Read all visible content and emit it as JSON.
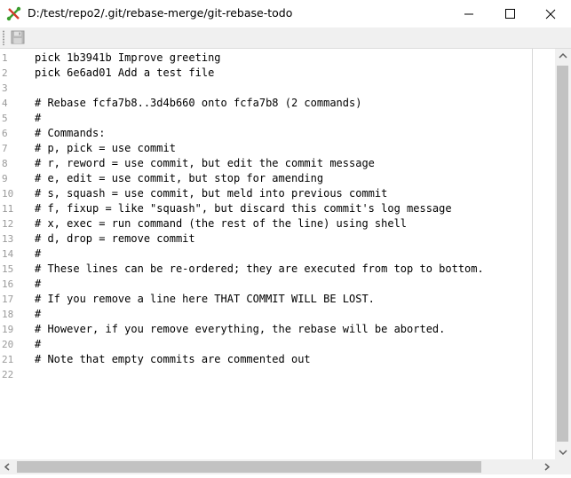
{
  "window": {
    "title": "D:/test/repo2/.git/rebase-merge/git-rebase-todo"
  },
  "icons": {
    "app": "git-app-icon",
    "save": "save-icon",
    "minimize": "minimize-icon",
    "maximize": "maximize-icon",
    "close": "close-icon"
  },
  "editor": {
    "lines": [
      {
        "n": "1",
        "text": "pick 1b3941b Improve greeting"
      },
      {
        "n": "2",
        "text": "pick 6e6ad01 Add a test file"
      },
      {
        "n": "3",
        "text": ""
      },
      {
        "n": "4",
        "text": "# Rebase fcfa7b8..3d4b660 onto fcfa7b8 (2 commands)"
      },
      {
        "n": "5",
        "text": "#"
      },
      {
        "n": "6",
        "text": "# Commands:"
      },
      {
        "n": "7",
        "text": "# p, pick = use commit"
      },
      {
        "n": "8",
        "text": "# r, reword = use commit, but edit the commit message"
      },
      {
        "n": "9",
        "text": "# e, edit = use commit, but stop for amending"
      },
      {
        "n": "10",
        "text": "# s, squash = use commit, but meld into previous commit"
      },
      {
        "n": "11",
        "text": "# f, fixup = like \"squash\", but discard this commit's log message"
      },
      {
        "n": "12",
        "text": "# x, exec = run command (the rest of the line) using shell"
      },
      {
        "n": "13",
        "text": "# d, drop = remove commit"
      },
      {
        "n": "14",
        "text": "#"
      },
      {
        "n": "15",
        "text": "# These lines can be re-ordered; they are executed from top to bottom."
      },
      {
        "n": "16",
        "text": "#"
      },
      {
        "n": "17",
        "text": "# If you remove a line here THAT COMMIT WILL BE LOST."
      },
      {
        "n": "18",
        "text": "#"
      },
      {
        "n": "19",
        "text": "# However, if you remove everything, the rebase will be aborted."
      },
      {
        "n": "20",
        "text": "#"
      },
      {
        "n": "21",
        "text": "# Note that empty commits are commented out"
      },
      {
        "n": "22",
        "text": ""
      }
    ]
  }
}
